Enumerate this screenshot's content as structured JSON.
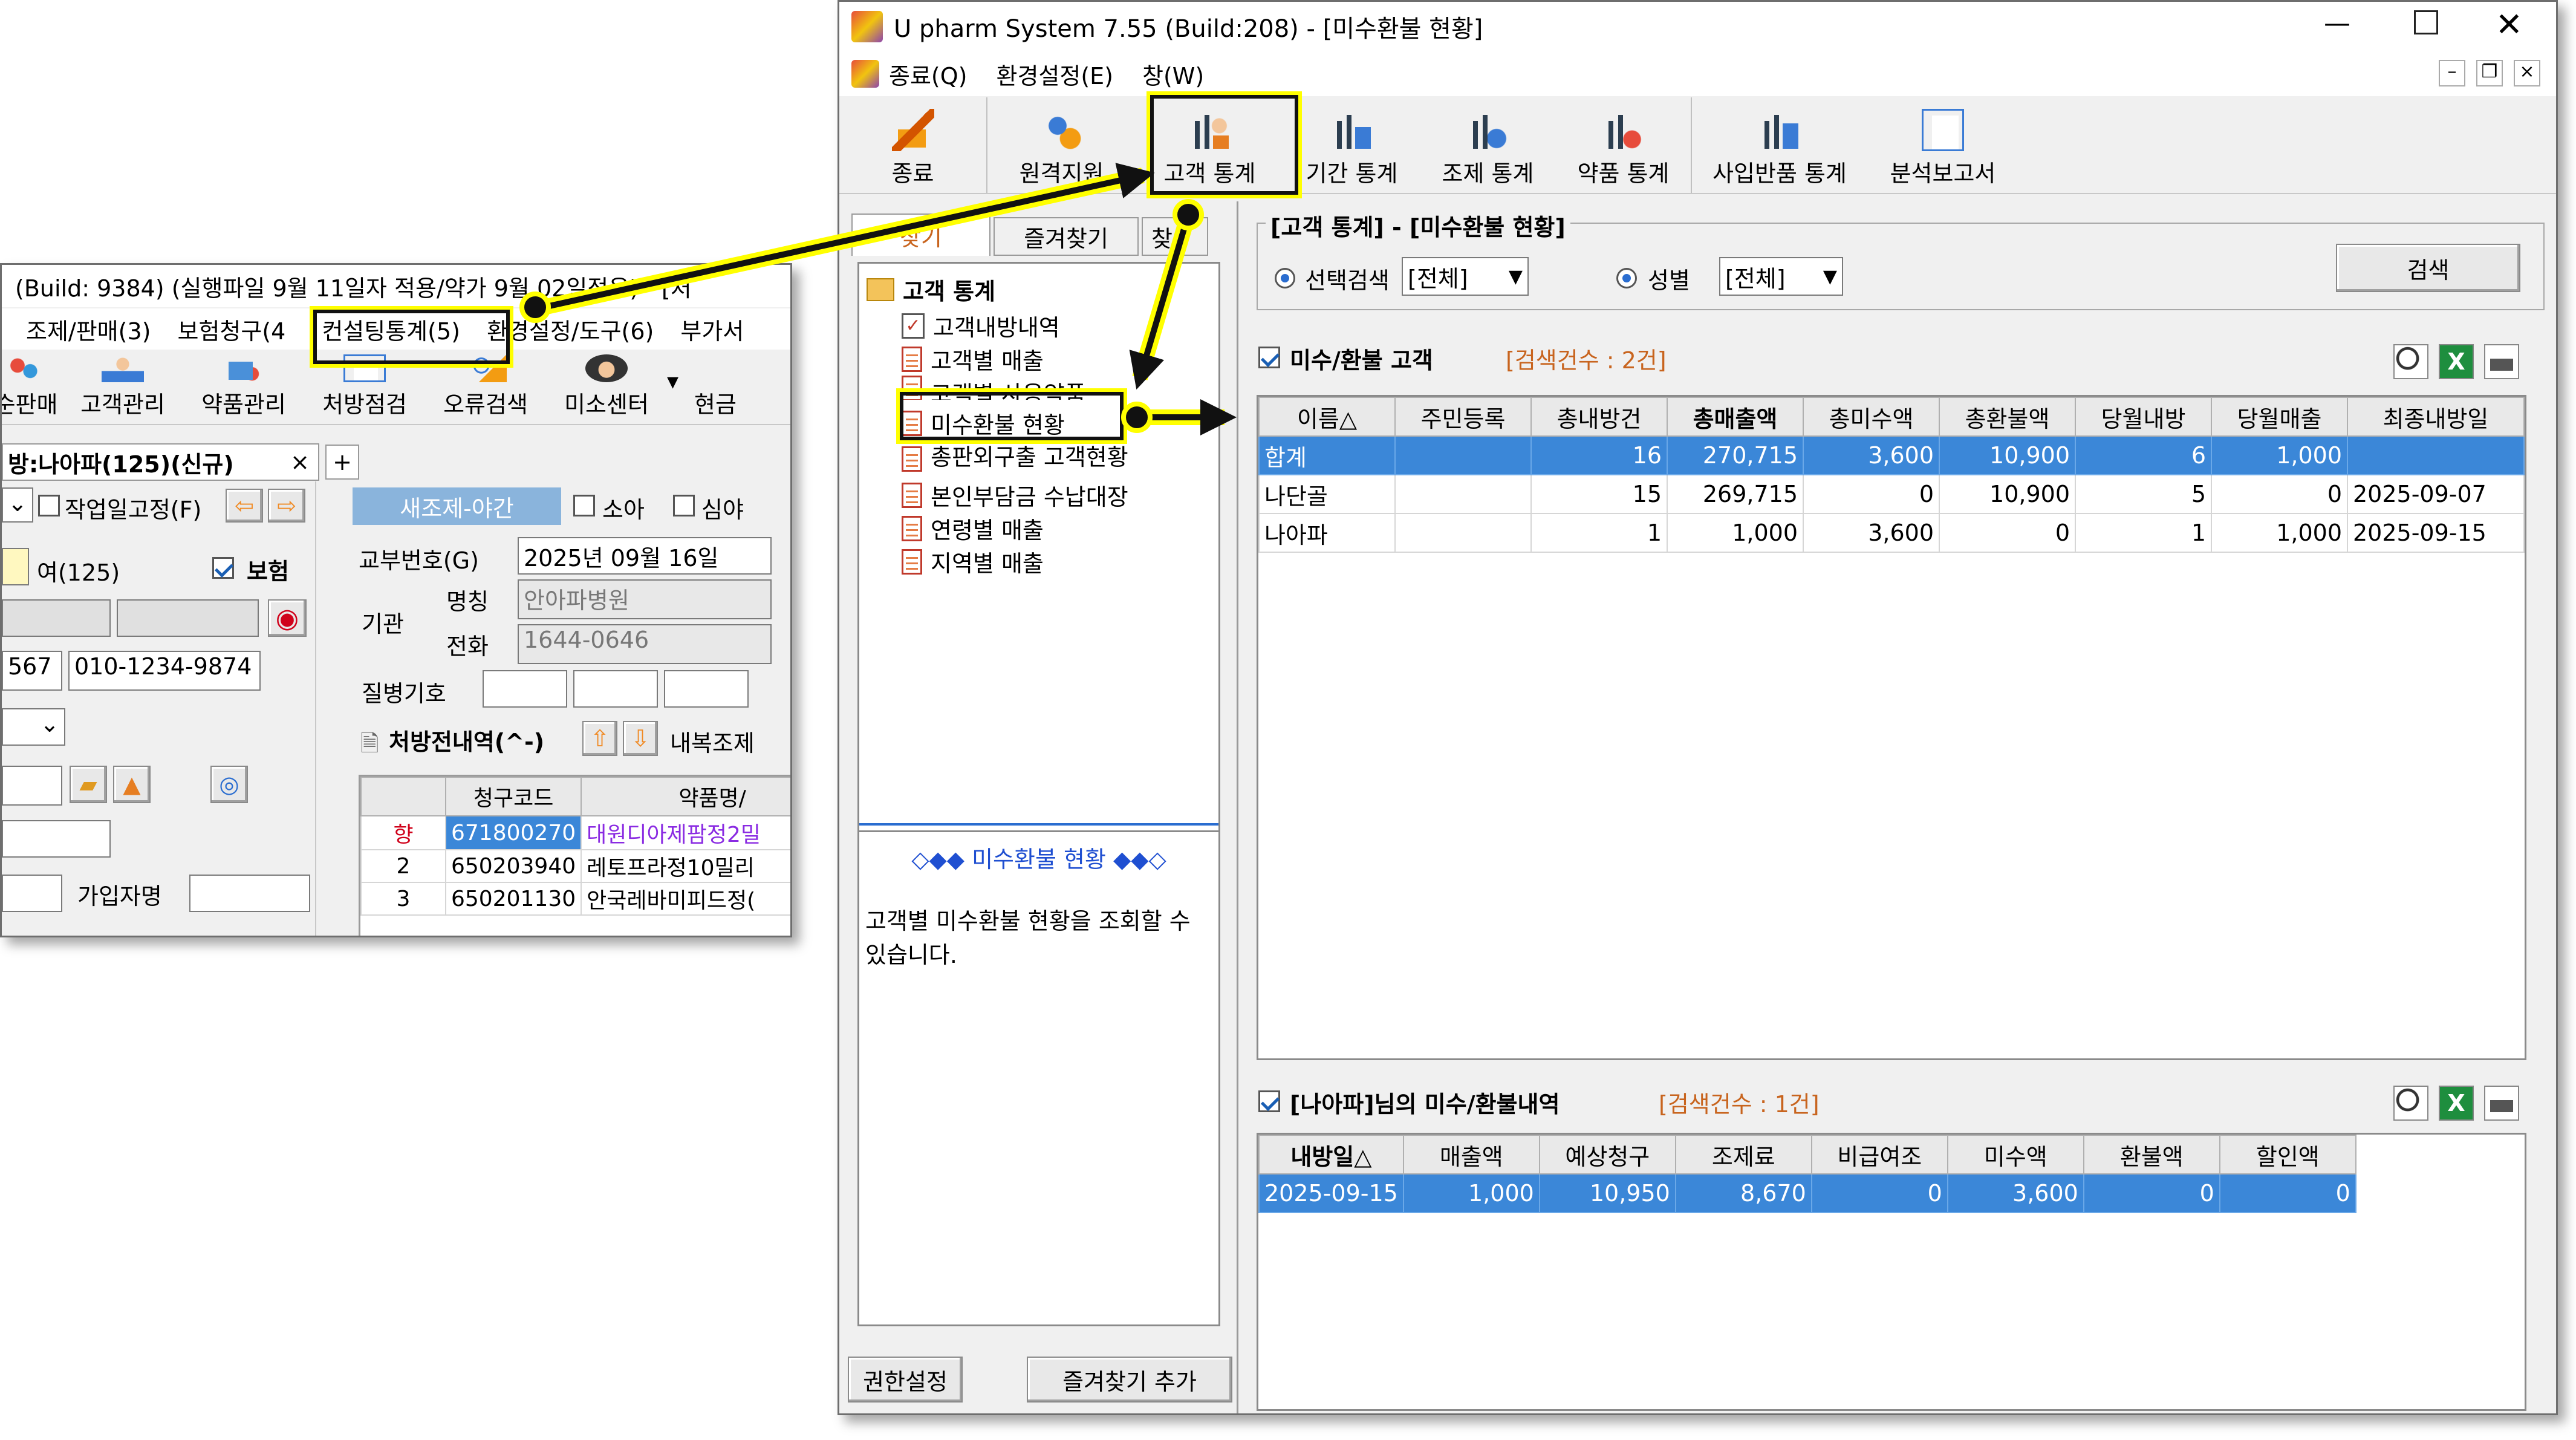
{
  "left_window": {
    "title": "(Build: 9384) (실행파일 9월 11일자 적용/약가 9월 02일적용) - [처",
    "menu": [
      "조제/판매(3)",
      "보험청구(4",
      "컨설팅통계(5)",
      "환경설정/도구(6)",
      "부가서"
    ],
    "toolbar": [
      "순판매",
      "고객관리",
      "약품관리",
      "처방점검",
      "오류검색",
      "미소센터",
      "현금"
    ],
    "tab": "방:나아파(125)(신규)",
    "tab_close": "×",
    "tab_add": "+",
    "fix_label": "작업일고정(F)",
    "mode_badge": "새조제-야간",
    "child_label": "소아",
    "night_label": "심야",
    "patient_sex": "여(125)",
    "insurance_label": "보험",
    "phone_prefix": "567",
    "phone": "010-1234-9874",
    "subscriber_label": "가입자명",
    "issue_no_label": "교부번호(G)",
    "issue_date": "2025년 09월 16일",
    "inst_label": "기관",
    "inst_name_label": "명칭",
    "inst_name": "안아파병원",
    "inst_phone_label": "전화",
    "inst_phone": "1644-0646",
    "disease_label": "질병기호",
    "rx_title": "처방전내역(^-)",
    "internal_label": "내복조제",
    "rx_headers": [
      "청구코드",
      "약품명/"
    ],
    "rx_rows": [
      [
        "향",
        "671800270",
        "대원디아제팜정2밀"
      ],
      [
        "2",
        "650203940",
        "레토프라정10밀리"
      ],
      [
        "3",
        "650201130",
        "안국레바미피드정("
      ]
    ]
  },
  "right_window": {
    "title": "U pharm System 7.55 (Build:208) - [미수환불 현황]",
    "menu": [
      "종료(Q)",
      "환경설정(E)",
      "창(W)"
    ],
    "toolbar": [
      "종료",
      "원격지원",
      "고객 통계",
      "기간 통계",
      "조제 통계",
      "약품 통계",
      "사입반품 통계",
      "분석보고서"
    ],
    "left_tabs": [
      "찾기",
      "즐겨찾기",
      "찾"
    ],
    "tree_root": "고객 통계",
    "tree_items": [
      "고객내방내역",
      "고객별 매출",
      "고객별 사용약품",
      "미수환불 현황",
      "총판외구출 고객현황",
      "본인부담금 수납대장",
      "연령별 매출",
      "지역별 매출"
    ],
    "desc_title": "◇◆◆ 미수환불 현황 ◆◆◇",
    "desc_text": "고객별 미수환불 현황을 조회할 수 있습니다.",
    "perm_button": "권한설정",
    "fav_add_button": "즐겨찾기 추가",
    "section_title": "[고객 통계] - [미수환불 현황]",
    "filter1_label": "선택검색",
    "filter1_value": "[전체]",
    "filter2_label": "성별",
    "filter2_value": "[전체]",
    "search_button": "검색",
    "grid1_title": "미수/환불 고객",
    "grid1_count": "[검색건수 : 2건]",
    "grid1_headers": [
      "이름△",
      "주민등록",
      "총내방건",
      "총매출액",
      "총미수액",
      "총환불액",
      "당월내방",
      "당월매출",
      "최종내방일"
    ],
    "grid1_rows": [
      [
        "합계",
        "",
        "16",
        "270,715",
        "3,600",
        "10,900",
        "6",
        "1,000",
        ""
      ],
      [
        "나단골",
        "",
        "15",
        "269,715",
        "0",
        "10,900",
        "5",
        "0",
        "2025-09-07"
      ],
      [
        "나아파",
        "",
        "1",
        "1,000",
        "3,600",
        "0",
        "1",
        "1,000",
        "2025-09-15"
      ]
    ],
    "grid2_title": "[나아파]님의 미수/환불내역",
    "grid2_count": "[검색건수 : 1건]",
    "grid2_headers": [
      "내방일△",
      "매출액",
      "예상청구",
      "조제료",
      "비급여조",
      "미수액",
      "환불액",
      "할인액"
    ],
    "grid2_rows": [
      [
        "2025-09-15",
        "1,000",
        "10,950",
        "8,670",
        "0",
        "3,600",
        "0",
        "0"
      ]
    ]
  }
}
